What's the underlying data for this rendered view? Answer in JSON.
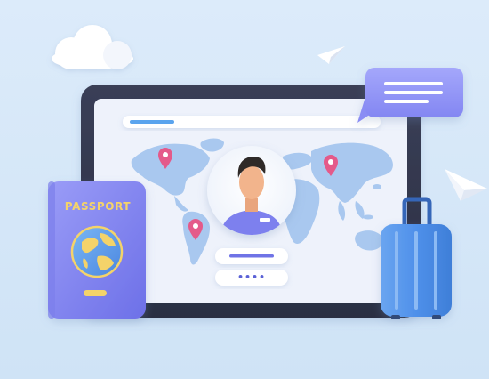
{
  "passport": {
    "title": "PASSPORT"
  },
  "login": {
    "password_mask": "••••"
  },
  "icons": {
    "cloud": "cloud-icon",
    "paper_plane": "paper-plane-icon",
    "chat_bubble": "chat-bubble-icon",
    "map_pin": "map-pin-icon",
    "globe": "globe-icon",
    "suitcase": "suitcase-icon",
    "user_avatar": "user-avatar-icon"
  },
  "colors": {
    "background": "#d5e8f8",
    "accent_purple": "#8b8ef5",
    "passport_gold": "#f4d36a",
    "pin_pink": "#e45a8a",
    "suitcase_blue": "#4a8de6",
    "map_blue": "#a9c8ef"
  }
}
